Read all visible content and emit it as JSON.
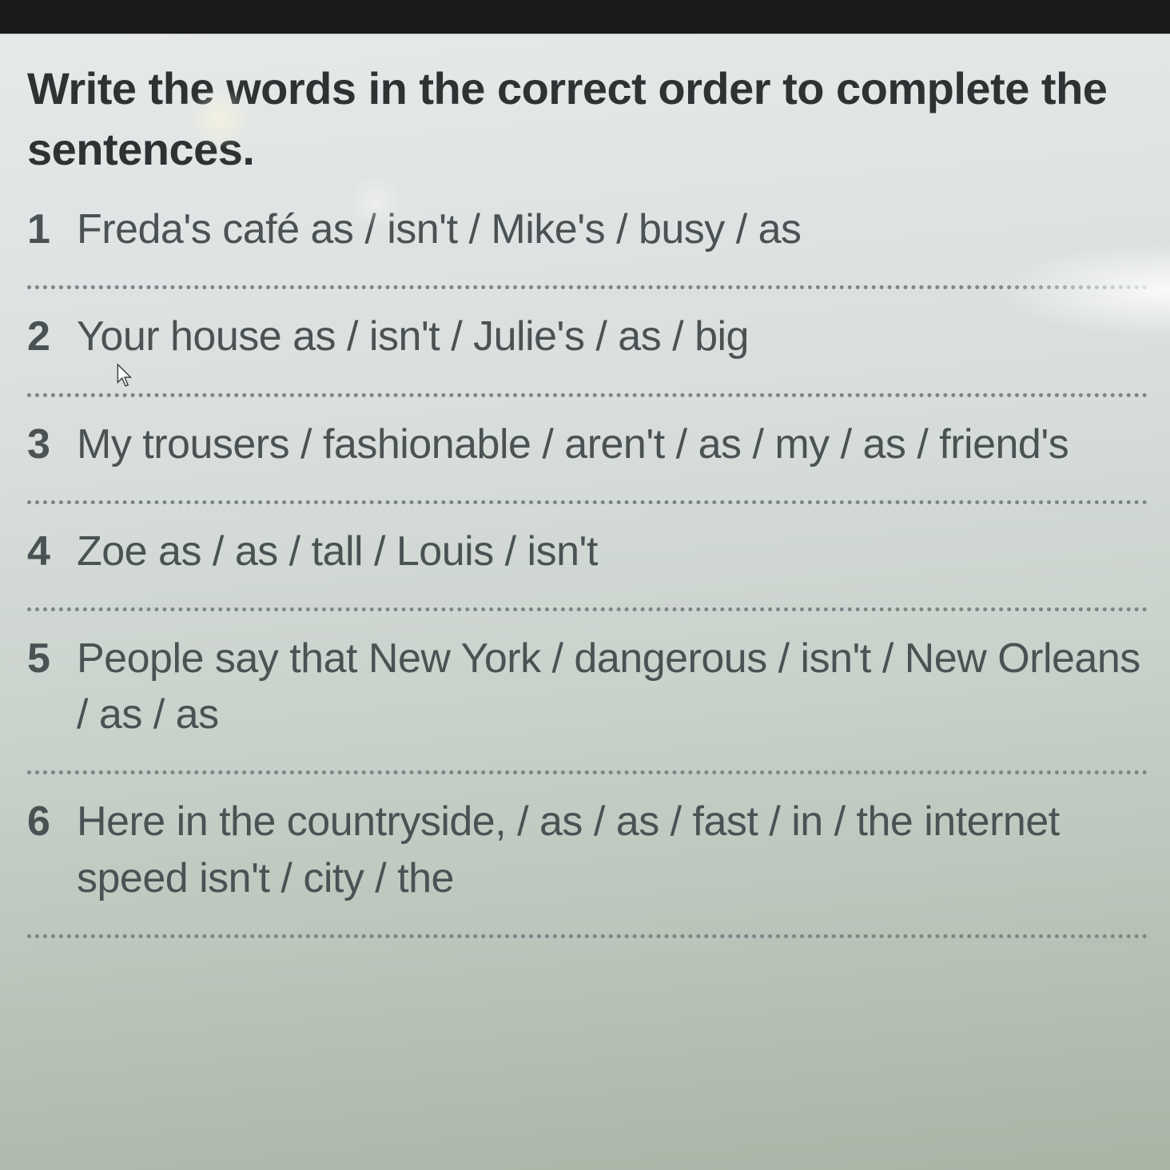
{
  "instruction": "Write the words in the correct order to complete the sentences.",
  "items": [
    {
      "num": "1",
      "text": "Freda's café as / isn't / Mike's / busy / as"
    },
    {
      "num": "2",
      "text": "Your house as / isn't / Julie's / as / big"
    },
    {
      "num": "3",
      "text": "My trousers / fashionable / aren't / as / my / as / friend's"
    },
    {
      "num": "4",
      "text": "Zoe as / as / tall / Louis / isn't"
    },
    {
      "num": "5",
      "text": "People say that New York / dangerous / isn't / New Orleans / as / as"
    },
    {
      "num": "6",
      "text": "Here in the countryside, / as / as / fast / in / the internet speed isn't / city / the"
    }
  ]
}
